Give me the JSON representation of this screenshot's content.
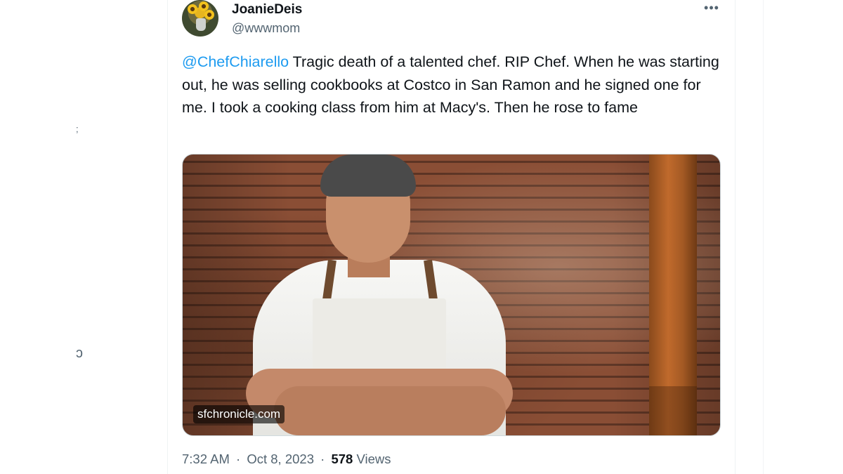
{
  "left_fragments": [
    ";",
    "ↄ"
  ],
  "tweet": {
    "author": {
      "display_name": "JoanieDeis",
      "handle": "@wwwmom"
    },
    "more_icon": "more-horizontal-icon",
    "text": {
      "mention": "@ChefChiarello",
      "body": " Tragic death of a talented chef.  RIP Chef.  When he was starting out, he was selling cookbooks at Costco in San Ramon and he signed one for me.  I took a cooking class from him at Macy's.  Then he rose to fame"
    },
    "media": {
      "source_label": "sfchronicle.com"
    },
    "meta": {
      "time": "7:32 AM",
      "date": "Oct 8, 2023",
      "separator": "·",
      "views_count": "578",
      "views_label": "Views"
    }
  },
  "colors": {
    "link": "#1d9bf0",
    "secondary_text": "#536471",
    "primary_text": "#0f1419",
    "border": "#eff3f4"
  }
}
